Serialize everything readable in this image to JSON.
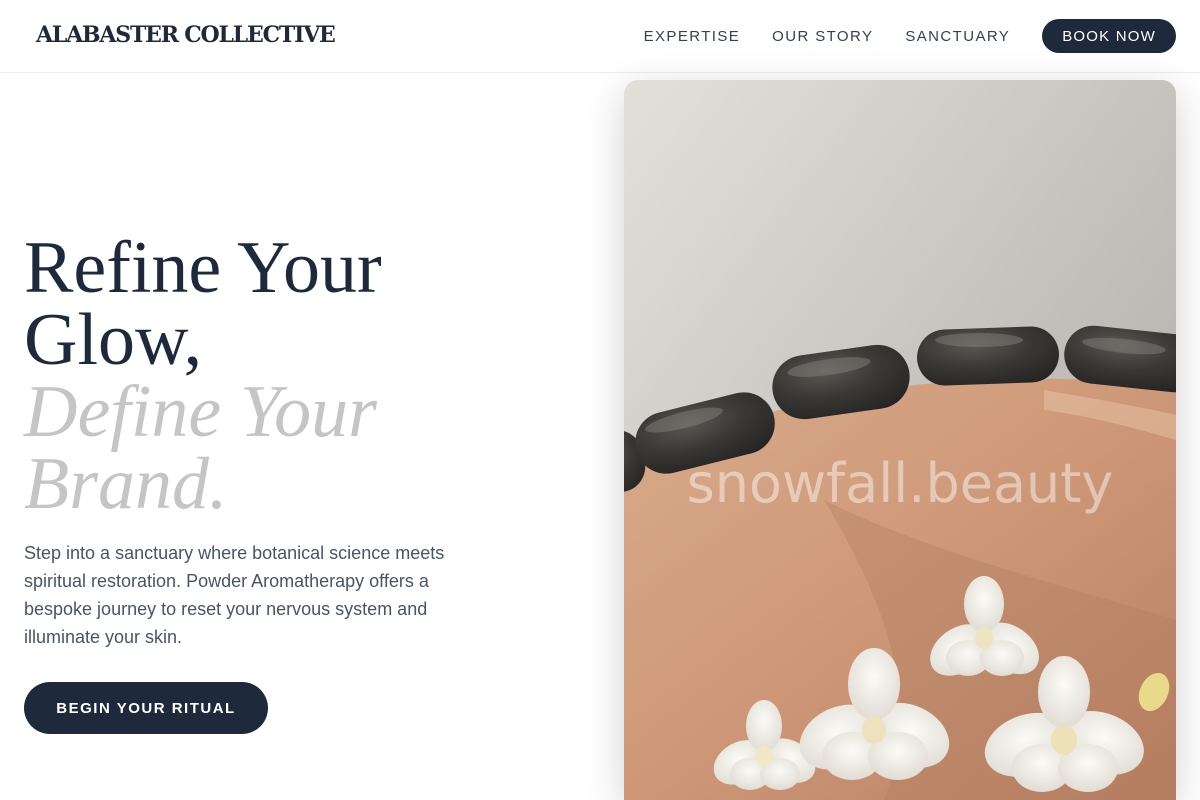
{
  "brand": {
    "name": "ALABASTER COLLECTIVE"
  },
  "nav": {
    "links": [
      "EXPERTISE",
      "OUR STORY",
      "SANCTUARY"
    ],
    "cta_label": "BOOK NOW"
  },
  "hero": {
    "title_line1": "Refine Your",
    "title_line2": "Glow,",
    "title_accent_line1": "Define Your",
    "title_accent_line2": "Brand.",
    "description": "Step into a sanctuary where botanical science meets spiritual restoration. Powder Aromatherapy offers a bespoke journey to reset your nervous system and illuminate your skin.",
    "cta_label": "BEGIN YOUR RITUAL"
  },
  "image": {
    "watermark": "snowfall.beauty",
    "subject": "hot stone massage with white orchids"
  },
  "colors": {
    "primary": "#1e293b",
    "accent_text": "#c5c5c5",
    "body_text": "#475569",
    "background": "#ffffff"
  }
}
